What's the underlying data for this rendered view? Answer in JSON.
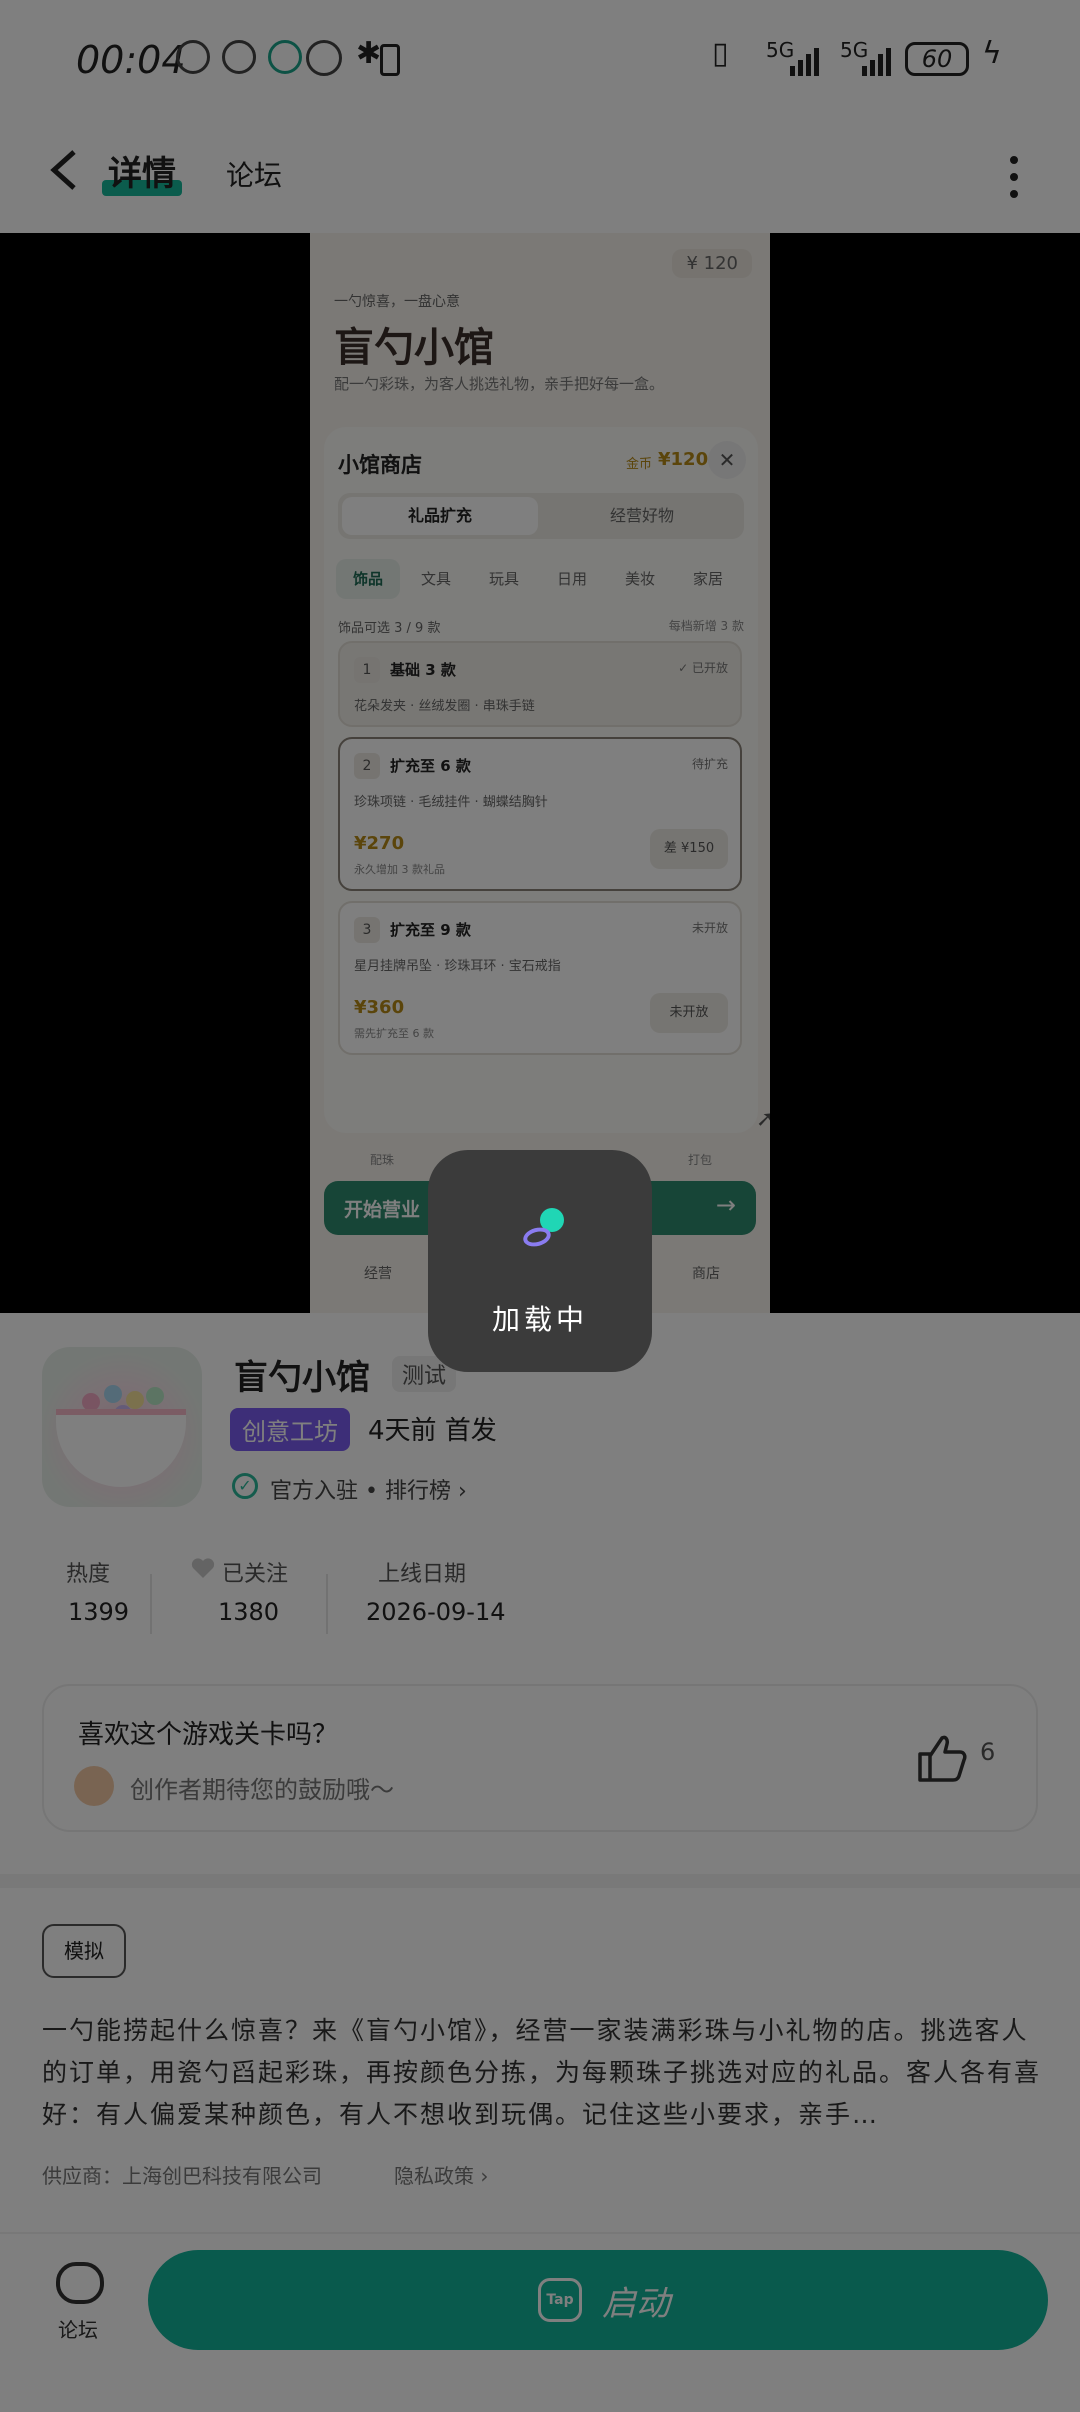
{
  "status_bar": {
    "time": "00:04",
    "net1": "5G",
    "net2": "5G",
    "battery": "60"
  },
  "header": {
    "tab_active": "详情",
    "tab_other": "论坛"
  },
  "preview": {
    "price_badge": "¥ 120",
    "subtitle": "一勺惊喜，一盘心意",
    "title": "盲勺小馆",
    "desc": "配一勺彩珠，为客人挑选礼物，亲手把好每一盒。",
    "modal": {
      "title": "小馆商店",
      "coin_label": "金币",
      "coin_value": "¥120",
      "segments": [
        "礼品扩充",
        "经营好物"
      ],
      "categories": [
        "饰品",
        "文具",
        "玩具",
        "日用",
        "美妆",
        "家居"
      ],
      "available": "饰品可选 3 / 9 款",
      "available_note": "每档新增 3 款",
      "tiers": [
        {
          "num": "1",
          "name": "基础 3 款",
          "tag": "✓ 已开放",
          "items": "花朵发夹 · 丝绒发圈 · 串珠手链",
          "price": "",
          "note": "",
          "button": ""
        },
        {
          "num": "2",
          "name": "扩充至 6 款",
          "tag": "待扩充",
          "items": "珍珠项链 · 毛绒挂件 · 蝴蝶结胸针",
          "price": "¥270",
          "note": "永久增加 3 款礼品",
          "button": "差 ¥150"
        },
        {
          "num": "3",
          "name": "扩充至 9 款",
          "tag": "未开放",
          "items": "星月挂牌吊坠 · 珍珠耳环 · 宝石戒指",
          "price": "¥360",
          "note": "需先扩充至 6 款",
          "button": "未开放"
        }
      ]
    },
    "bottom_labels": [
      "配珠",
      "打包"
    ],
    "start_label": "开始营业",
    "start_arrow": "→",
    "bottom_tabs": [
      "经营",
      "商店"
    ]
  },
  "game": {
    "name": "盲勺小馆",
    "test_tag": "测试",
    "workshop_tag": "创意工坊",
    "first_release": "4天前 首发",
    "official": "官方入驻 • 排行榜",
    "stats": [
      {
        "label": "热度",
        "value": "1399"
      },
      {
        "label": "已关注",
        "value": "1380"
      },
      {
        "label": "上线日期",
        "value": "2026-09-14"
      }
    ]
  },
  "like_card": {
    "question": "喜欢这个游戏关卡吗？",
    "message": "创作者期待您的鼓励哦～",
    "count": "6"
  },
  "info": {
    "tag": "模拟",
    "description": "一勺能捞起什么惊喜？来《盲勺小馆》，经营一家装满彩珠与小礼物的店。挑选客人的订单，用瓷勺舀起彩珠，再按颜色分拣，为每颗珠子挑选对应的礼品。客人各有喜好：有人偏爱某种颜色，有人不想收到玩偶。记住这些小要求，亲手…",
    "supplier": "供应商：上海创巴科技有限公司",
    "privacy": "隐私政策"
  },
  "bottom_bar": {
    "forum_label": "论坛",
    "launch_label": "启动",
    "logo": "Tap"
  },
  "loading": {
    "text": "加载中"
  }
}
